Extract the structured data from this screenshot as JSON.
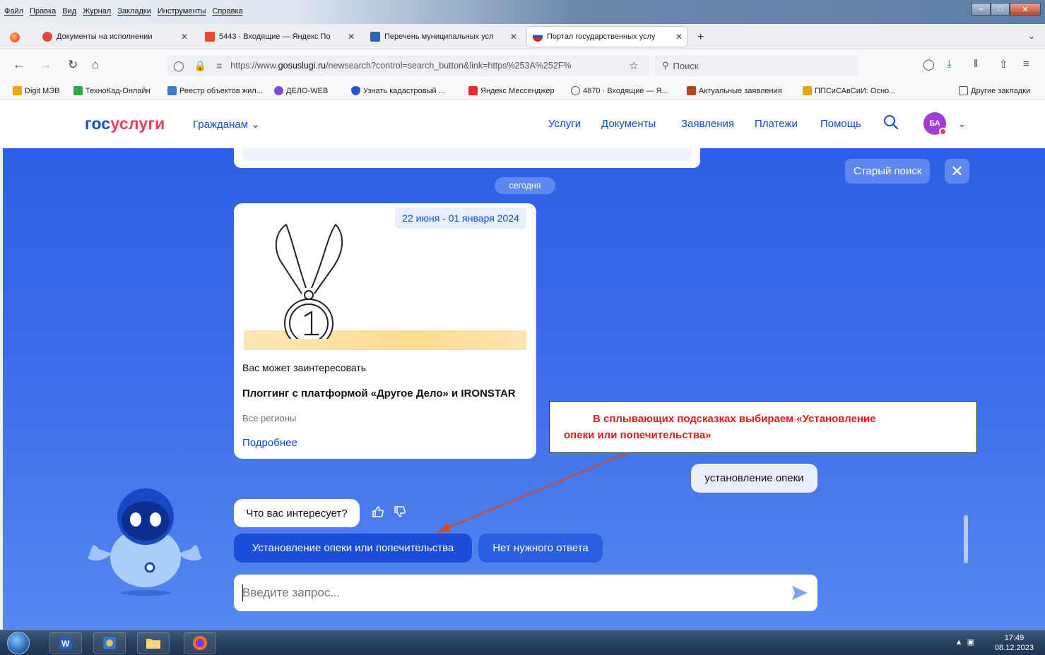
{
  "browser": {
    "menu": [
      "Файл",
      "Правка",
      "Вид",
      "Журнал",
      "Закладки",
      "Инструменты",
      "Справка"
    ],
    "tabs": [
      {
        "title": "Документы на исполнении",
        "color": "#e0473b"
      },
      {
        "title": "5443 · Входящие — Яндекс По",
        "color": "#e84a2b"
      },
      {
        "title": "Перечень муниципальных усл",
        "color": "#2a63b8"
      },
      {
        "title": "Портал государственных услу",
        "color": "#2155d6"
      }
    ],
    "url_prefix": "https://www.",
    "url_domain": "gosuslugi.ru",
    "url_rest": "/newsearch?control=search_button&link=https%253A%252F%",
    "search_placeholder": "Поиск",
    "bookmarks": [
      {
        "label": "Digit МЭВ",
        "color": "#f5a30f"
      },
      {
        "label": "ТехноКад-Онлайн",
        "color": "#2aa84a"
      },
      {
        "label": "Реестр объектов жил...",
        "color": "#3a7bd5"
      },
      {
        "label": "ДЕЛО-WEB",
        "color": "#7b4bd1"
      },
      {
        "label": "Узнать кадастровый ...",
        "color": "#2a54c8"
      },
      {
        "label": "Яндекс Мессенджер",
        "color": "#e42d2d"
      },
      {
        "label": "4870 · Входящие — Я...",
        "color": "#555555"
      },
      {
        "label": "Актуальные заявления",
        "color": "#b4451f"
      },
      {
        "label": "ППСиСАвСиИ: Осно...",
        "color": "#e8a11a"
      }
    ],
    "other_bookmarks": "Другие закладки"
  },
  "portal": {
    "logo_part1": "гос",
    "logo_part2": "услуги",
    "citizens": "Гражданам",
    "nav": [
      "Услуги",
      "Документы",
      "Заявления",
      "Платежи",
      "Помощь"
    ],
    "avatar_initials": "БА"
  },
  "chat": {
    "old_search": "Старый поиск",
    "date_chip": "сегодня",
    "card": {
      "date_range": "22 июня - 01 января 2024",
      "kicker": "Вас может заинтересовать",
      "headline": "Плоггинг с платформой «Другое Дело» и IRONSTAR",
      "region": "Все регионы",
      "more": "Подробнее"
    },
    "annotation_line1": "В сплывающих подсказках выбираем «Установление",
    "annotation_line2": "опеки или попечительства»",
    "user_message": "установление опеки",
    "bot_question": "Что вас интересует?",
    "chips": [
      "Установление опеки или попечительства",
      "Нет нужного ответа"
    ],
    "input_placeholder": "Введите запрос..."
  },
  "taskbar": {
    "time": "17:49",
    "date": "08.12.2023"
  },
  "colors": {
    "brand_blue": "#0d4cd3",
    "brand_red": "#ee3f58",
    "annotation_red": "#e21b1b"
  }
}
